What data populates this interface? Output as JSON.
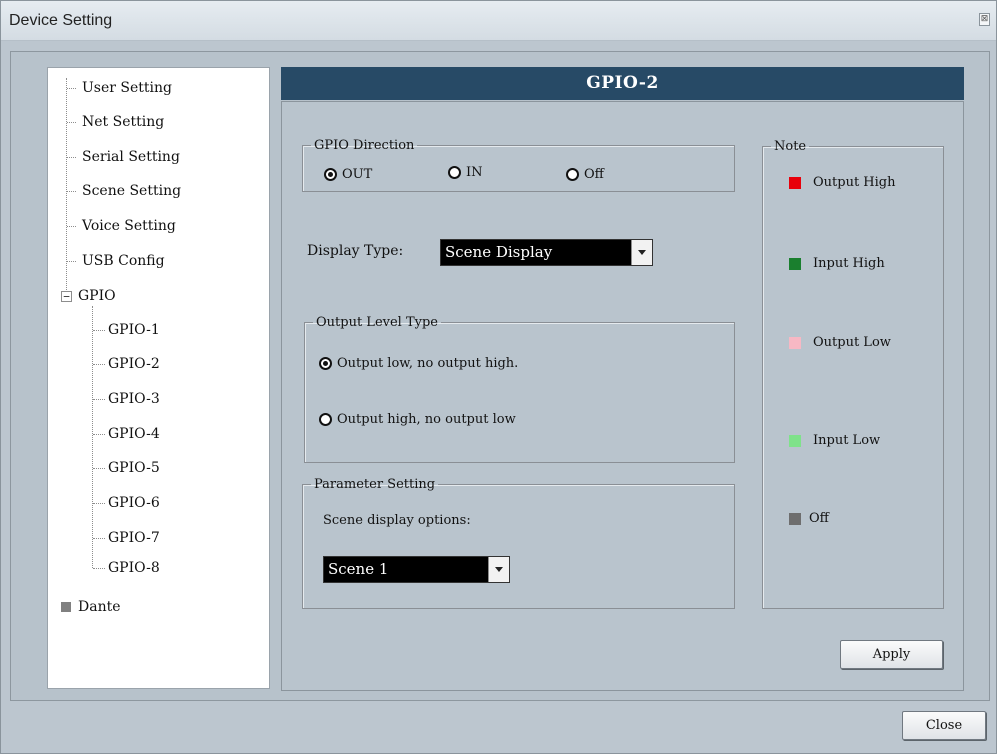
{
  "window": {
    "title": "Device Setting",
    "close_glyph": "⊠"
  },
  "tree": {
    "items": [
      {
        "label": "User Setting"
      },
      {
        "label": "Net Setting"
      },
      {
        "label": "Serial Setting"
      },
      {
        "label": "Scene Setting"
      },
      {
        "label": "Voice Setting"
      },
      {
        "label": "USB Config"
      },
      {
        "label": "GPIO",
        "expander": "−"
      },
      {
        "label": "GPIO-1"
      },
      {
        "label": "GPIO-2"
      },
      {
        "label": "GPIO-3"
      },
      {
        "label": "GPIO-4"
      },
      {
        "label": "GPIO-5"
      },
      {
        "label": "GPIO-6"
      },
      {
        "label": "GPIO-7"
      },
      {
        "label": "GPIO-8"
      },
      {
        "label": "Dante"
      }
    ]
  },
  "panel": {
    "header": "GPIO-2",
    "direction": {
      "legend": "GPIO Direction",
      "options": [
        {
          "label": "OUT",
          "checked": true
        },
        {
          "label": "IN",
          "checked": false
        },
        {
          "label": "Off",
          "checked": false
        }
      ]
    },
    "display_type": {
      "label": "Display Type:",
      "value": "Scene Display"
    },
    "output_level": {
      "legend": "Output Level Type",
      "options": [
        {
          "label": "Output low, no output high.",
          "checked": true
        },
        {
          "label": "Output high, no output low",
          "checked": false
        }
      ]
    },
    "parameter": {
      "legend": "Parameter Setting",
      "label": "Scene display options:",
      "value": "Scene 1"
    },
    "note": {
      "legend": "Note",
      "items": [
        {
          "label": "Output High",
          "color": "#e8000b"
        },
        {
          "label": "Input High",
          "color": "#1a7f2e"
        },
        {
          "label": "Output Low",
          "color": "#f7b8c4"
        },
        {
          "label": "Input  Low",
          "color": "#7fe28a"
        },
        {
          "label": "Off",
          "color": "#6e6e6e"
        }
      ]
    },
    "apply_label": "Apply"
  },
  "footer": {
    "close_label": "Close"
  }
}
